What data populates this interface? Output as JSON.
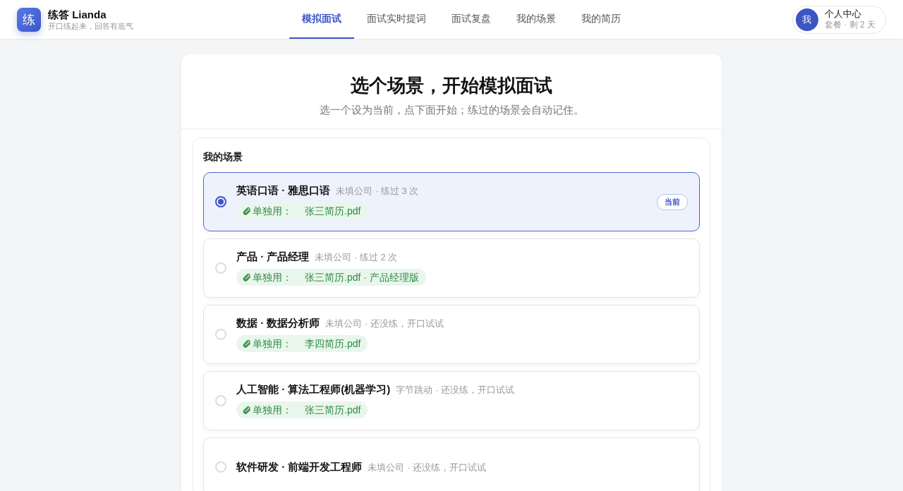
{
  "header": {
    "logo_glyph": "练",
    "brand": "练答 Lianda",
    "tagline": "开口练起来，回答有底气",
    "nav": [
      {
        "label": "模拟面试",
        "selected": true
      },
      {
        "label": "面试实时提词",
        "selected": false
      },
      {
        "label": "面试复盘",
        "selected": false
      },
      {
        "label": "我的场景",
        "selected": false
      },
      {
        "label": "我的简历",
        "selected": false
      }
    ],
    "user": {
      "avatar": "我",
      "title": "个人中心",
      "subtitle": "套餐 · 剩 2 天"
    }
  },
  "hero": {
    "title": "选个场景，开始模拟面试",
    "subtitle": "选一个设为当前，点下面开始；练过的场景会自动记住。"
  },
  "scenes": {
    "heading": "我的场景",
    "items": [
      {
        "name": "英语口语 · 雅思口语",
        "meta": "未填公司 · 练过 3 次",
        "resume_label": "单独用：",
        "resume": "张三简历.pdf",
        "selected": true,
        "badge": "当前"
      },
      {
        "name": "产品 · 产品经理",
        "meta": "未填公司 · 练过 2 次",
        "resume_label": "单独用：",
        "resume": "张三简历.pdf · 产品经理版",
        "selected": false
      },
      {
        "name": "数据 · 数据分析师",
        "meta": "未填公司 · 还没练，开口试试",
        "resume_label": "单独用：",
        "resume": "李四简历.pdf",
        "selected": false
      },
      {
        "name": "人工智能 · 算法工程师(机器学习)",
        "meta": "字节跳动 · 还没练，开口试试",
        "resume_label": "单独用：",
        "resume": "张三简历.pdf",
        "selected": false
      },
      {
        "name": "软件研发 · 前端开发工程师",
        "meta": "未填公司 · 还没练，开口试试",
        "selected": false
      }
    ]
  }
}
